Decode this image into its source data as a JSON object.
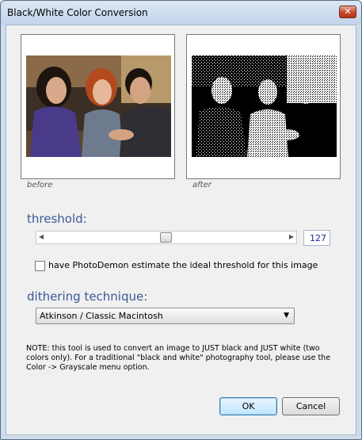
{
  "window": {
    "title": "Black/White Color Conversion",
    "close_icon": "close-icon"
  },
  "previews": {
    "before_caption": "before",
    "after_caption": "after"
  },
  "threshold": {
    "label": "threshold:",
    "value": "127",
    "min": 0,
    "max": 255,
    "estimate_label": "have PhotoDemon estimate the ideal threshold for this image",
    "estimate_checked": false
  },
  "dithering": {
    "label": "dithering technique:",
    "selected": "Atkinson / Classic Macintosh"
  },
  "note": "NOTE: this tool is used to convert an image to JUST black and JUST white (two colors only).  For a traditional \"black and white\" photography tool, please use the Color -> Grayscale menu option.",
  "buttons": {
    "ok": "OK",
    "cancel": "Cancel"
  },
  "colors": {
    "heading": "#3b5998",
    "value_text": "#1a2a8c",
    "close_red": "#c7452a",
    "ok_blue": "#3c7fb1"
  }
}
